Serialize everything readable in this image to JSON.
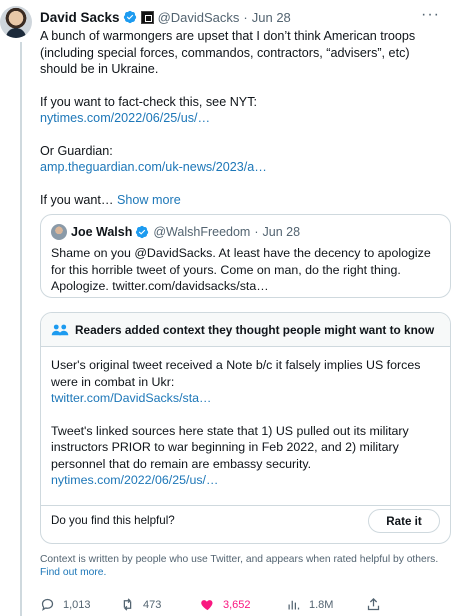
{
  "author": {
    "name": "David Sacks",
    "handle": "@DavidSacks",
    "separator": "·",
    "date": "Jun 28"
  },
  "tweet": {
    "p1": "A bunch of warmongers are upset that I don’t think American troops (including special forces, commandos, contractors, “advisers”, etc) should be in Ukraine.",
    "p2_text": "If you want to fact-check this, see NYT:",
    "p2_link": "nytimes.com/2022/06/25/us/…",
    "p3_text": "Or Guardian:",
    "p3_link": "amp.theguardian.com/uk-news/2023/a…",
    "p4_text": "If you want…",
    "show_more": "Show more"
  },
  "quoted": {
    "name": "Joe Walsh",
    "handle": "@WalshFreedom",
    "separator": "·",
    "date": "Jun 28",
    "text": "Shame on you @DavidSacks. At least have the decency to apologize for this horrible tweet of yours. Come on man, do the right thing. Apologize. twitter.com/davidsacks/sta…"
  },
  "note": {
    "heading": "Readers added context they thought people might want to know",
    "p1_text": "User's original tweet received a Note b/c it falsely implies US forces were in combat in Ukr:",
    "p1_link": "twitter.com/DavidSacks/sta…",
    "p2_text": "Tweet's linked sources here state that 1) US pulled out its military instructors PRIOR to war beginning in Feb 2022, and 2) military personnel that do remain are embassy security.",
    "p2_link": "nytimes.com/2022/06/25/us/…",
    "question": "Do you find this helpful?",
    "rate_button": "Rate it"
  },
  "footnote": {
    "text": "Context is written by people who use Twitter, and appears when rated helpful by others.",
    "link": "Find out more."
  },
  "actions": {
    "replies": "1,013",
    "retweets": "473",
    "likes": "3,652",
    "views": "1.8M"
  },
  "colors": {
    "link": "#1d77b8",
    "verified": "#1d9bf0",
    "like": "#f91880",
    "muted": "#536471"
  }
}
